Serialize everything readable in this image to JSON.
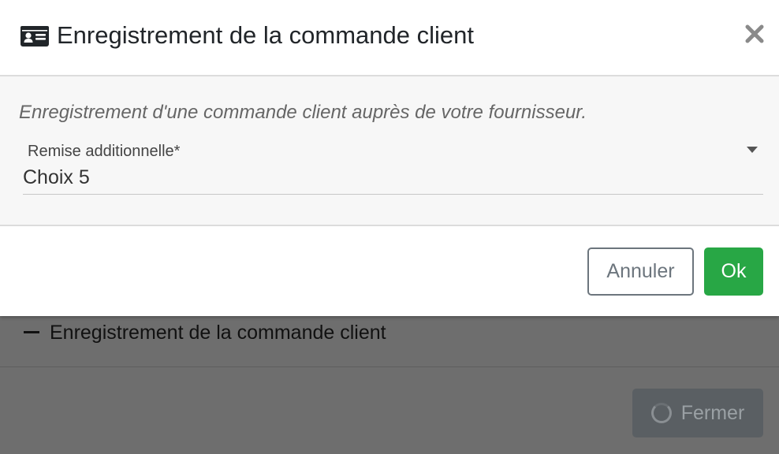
{
  "background": {
    "section_title": "Enregistrement de la commande client",
    "close_button_label": "Fermer",
    "section_toggle_icon": "minus-icon",
    "close_button_icon": "spinner-icon"
  },
  "modal": {
    "title": "Enregistrement de la commande client",
    "title_icon": "id-card-icon",
    "close_icon": "close-icon",
    "description": "Enregistrement d'une commande client auprès de votre fournisseur.",
    "field": {
      "label": "Remise additionnelle*",
      "value": "Choix 5",
      "dropdown_icon": "caret-down-icon"
    },
    "buttons": {
      "cancel_label": "Annuler",
      "ok_label": "Ok"
    }
  },
  "colors": {
    "ok_button": "#28a745",
    "cancel_border": "#6c757d",
    "overlay": "#6e6e6e"
  }
}
